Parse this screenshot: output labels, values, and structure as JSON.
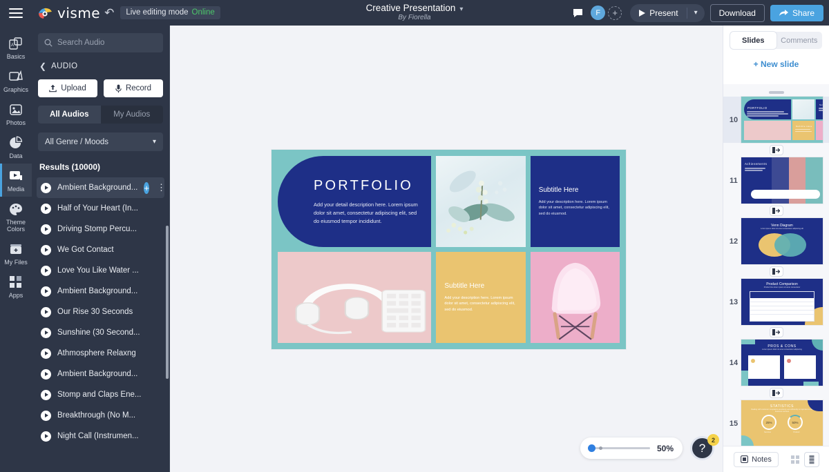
{
  "topbar": {
    "menu_icon": "hamburger-icon",
    "brand": "visme",
    "undo_icon": "undo-icon",
    "live_label": "Live editing mode",
    "live_status": "Online",
    "doc_title": "Creative Presentation",
    "doc_author": "By Fiorella",
    "comment_icon": "comment-icon",
    "avatar_initial": "F",
    "avatar_add": "+",
    "present_label": "Present",
    "download_label": "Download",
    "share_label": "Share"
  },
  "rail": {
    "items": [
      {
        "label": "Basics",
        "icon": "basics-icon",
        "active": false
      },
      {
        "label": "Graphics",
        "icon": "graphics-icon",
        "active": false
      },
      {
        "label": "Photos",
        "icon": "photos-icon",
        "active": false
      },
      {
        "label": "Data",
        "icon": "data-icon",
        "active": false
      },
      {
        "label": "Media",
        "icon": "media-icon",
        "active": true
      },
      {
        "label": "Theme Colors",
        "icon": "palette-icon",
        "active": false
      },
      {
        "label": "My Files",
        "icon": "files-icon",
        "active": false
      },
      {
        "label": "Apps",
        "icon": "apps-icon",
        "active": false
      }
    ]
  },
  "panel": {
    "search_placeholder": "Search Audio",
    "breadcrumb": "AUDIO",
    "upload_label": "Upload",
    "record_label": "Record",
    "tab_all": "All Audios",
    "tab_mine": "My Audios",
    "genre_select": "All Genre / Moods",
    "results_label": "Results (10000)",
    "tracks": [
      {
        "name": "Ambient Background...",
        "selected": true
      },
      {
        "name": "Half of Your Heart (In...",
        "selected": false
      },
      {
        "name": "Driving Stomp Percu...",
        "selected": false
      },
      {
        "name": "We Got Contact",
        "selected": false
      },
      {
        "name": "Love You Like Water ...",
        "selected": false
      },
      {
        "name": "Ambient Background...",
        "selected": false
      },
      {
        "name": "Our Rise 30 Seconds",
        "selected": false
      },
      {
        "name": "Sunshine (30 Second...",
        "selected": false
      },
      {
        "name": "Athmosphere Relaxng",
        "selected": false
      },
      {
        "name": "Ambient Background...",
        "selected": false
      },
      {
        "name": "Stomp and Claps Ene...",
        "selected": false
      },
      {
        "name": "Breakthrough (No M...",
        "selected": false
      },
      {
        "name": "Night Call (Instrumen...",
        "selected": false
      }
    ]
  },
  "slide": {
    "portfolio_title": "PORTFOLIO",
    "portfolio_text": "Add your detail description here. Lorem ipsum dolor sit amet, consectetur adipiscing elit, sed do eiusmod tempor incididunt.",
    "navy_subtitle": "Subtitle Here",
    "navy_text": "Add your description here. Lorem ipsum dolor sit amet, consectetur adipiscing elit, sed do eiusmod.",
    "gold_subtitle": "Subtitle Here",
    "gold_text": "Add your description here. Lorem ipsum dolor sit amet, consectetur adipiscing elit, sed do eiusmod.",
    "image_floral": "floral-watercolor-image",
    "image_headphones": "headphones-photo",
    "image_chair": "pink-chair-photo",
    "bg_color": "#7bc5c5",
    "navy_color": "#1e2f87",
    "gold_color": "#eac470"
  },
  "zoom": {
    "value": "50%",
    "help_icon": "?",
    "help_badge": "2"
  },
  "right": {
    "tab_slides": "Slides",
    "tab_comments": "Comments",
    "new_slide": "+ New slide",
    "notes_label": "Notes",
    "grid_view_icon": "grid-view-icon",
    "list_view_icon": "list-view-icon",
    "slides": [
      {
        "num": "10",
        "title": "PORTFOLIO",
        "kind": "portfolio",
        "current": true
      },
      {
        "num": "11",
        "title": "Achievements",
        "kind": "achievements",
        "current": false
      },
      {
        "num": "12",
        "title": "Venn Diagram",
        "kind": "venn",
        "current": false
      },
      {
        "num": "13",
        "title": "Product Comparison",
        "kind": "table",
        "current": false
      },
      {
        "num": "14",
        "title": "PROS & CONS",
        "kind": "proscons",
        "current": false
      },
      {
        "num": "15",
        "title": "STATISTICS",
        "kind": "stats",
        "current": false
      }
    ],
    "venn_subtitle": "Lorem ipsum dolor sit amet consectetur adipiscing elit",
    "proscons_subtitle": "Lorem ipsum dolor sit amet consectetur adipiscing",
    "stats_subtitle": "Dealing with customer complaints sensitively and efficiently is important to our business success",
    "stats_values": [
      "25%",
      "50%"
    ],
    "stats_labels": [
      "Services",
      "Product"
    ],
    "table_subtitle": "Product line lorem ipsum sit amet consectetur"
  }
}
